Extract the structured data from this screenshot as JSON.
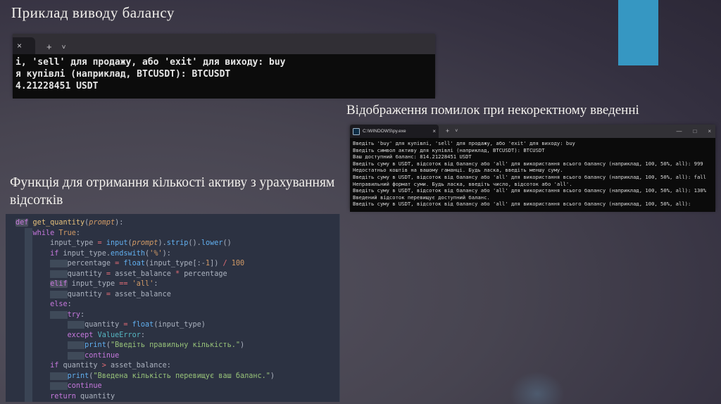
{
  "slide": {
    "title": "Приклад виводу балансу",
    "error_heading": "Відображення помилок при некоректному введенні",
    "function_heading": "Функція для отримання кількості активу з урахуванням відсотків"
  },
  "colors": {
    "accent_blue": "#3697c2",
    "terminal_bg": "#0c0c0c",
    "code_bg": "#2c3242",
    "slide_dark": "#272331"
  },
  "terminal_small": {
    "tab_close": "×",
    "new_tab": "+",
    "dropdown": "˅",
    "lines": [
      "і, 'sell' для продажу, або 'exit' для виходу: buy",
      "я купівлі (наприклад, BTCUSDT): BTCUSDT",
      "4.21228451 USDT"
    ]
  },
  "terminal_large": {
    "title": "C:\\WINDOWS\\py.exe",
    "tab_close": "×",
    "new_tab": "+",
    "dropdown": "˅",
    "window_controls": {
      "minimize": "—",
      "maximize": "□",
      "close": "×"
    },
    "lines": [
      "Введіть 'buy' для купівлі, 'sell' для продажу, або 'exit' для виходу: buy",
      "Введіть символ активу для купівлі (наприклад, BTCUSDT): BTCUSDT",
      "Ваш доступний баланс: 814.21228451 USDT",
      "Введіть суму в USDT, відсоток від балансу або 'all' для використання всього балансу (наприклад, 100, 50%, all): 999",
      "Недостатньо коштів на вашому гаманці. Будь ласка, введіть меншу суму.",
      "Введіть суму в USDT, відсоток від балансу або 'all' для використання всього балансу (наприклад, 100, 50%, all): fall",
      "Неправильний формат суми. Будь ласка, введіть число, відсоток або 'all'.",
      "Введіть суму в USDT, відсоток від балансу або 'all' для використання всього балансу (наприклад, 100, 50%, all): 130%",
      "Введений відсоток перевищує доступний баланс.",
      "Введіть суму в USDT, відсоток від балансу або 'all' для використання всього балансу (наприклад, 100, 50%, all):"
    ]
  },
  "code": {
    "language": "python",
    "lines": [
      {
        "tokens": [
          {
            "t": "def",
            "c": "k kbg"
          },
          {
            "t": " ",
            "c": "p"
          },
          {
            "t": "get_quantity",
            "c": "fn"
          },
          {
            "t": "(",
            "c": "p"
          },
          {
            "t": "prompt",
            "c": "pa"
          },
          {
            "t": "):",
            "c": "p"
          }
        ]
      },
      {
        "tokens": [
          {
            "t": "    ",
            "c": "p"
          },
          {
            "t": "while",
            "c": "k"
          },
          {
            "t": " ",
            "c": "p"
          },
          {
            "t": "True",
            "c": "num"
          },
          {
            "t": ":",
            "c": "p"
          }
        ]
      },
      {
        "tokens": [
          {
            "t": "        ",
            "c": "p"
          },
          {
            "t": "input_type ",
            "c": "p"
          },
          {
            "t": "=",
            "c": "op"
          },
          {
            "t": " ",
            "c": "p"
          },
          {
            "t": "input",
            "c": "bi"
          },
          {
            "t": "(",
            "c": "p"
          },
          {
            "t": "prompt",
            "c": "pa"
          },
          {
            "t": ").",
            "c": "p"
          },
          {
            "t": "strip",
            "c": "bi"
          },
          {
            "t": "().",
            "c": "p"
          },
          {
            "t": "lower",
            "c": "bi"
          },
          {
            "t": "()",
            "c": "p"
          }
        ]
      },
      {
        "tokens": [
          {
            "t": "        ",
            "c": "p"
          },
          {
            "t": "if",
            "c": "k"
          },
          {
            "t": " input_type.",
            "c": "p"
          },
          {
            "t": "endswith",
            "c": "bi"
          },
          {
            "t": "(",
            "c": "p"
          },
          {
            "t": "'%'",
            "c": "str2"
          },
          {
            "t": "):",
            "c": "p"
          }
        ]
      },
      {
        "tokens": [
          {
            "t": "        ",
            "c": "p"
          },
          {
            "t": "    ",
            "c": "ghost"
          },
          {
            "t": "percentage ",
            "c": "p"
          },
          {
            "t": "=",
            "c": "op"
          },
          {
            "t": " ",
            "c": "p"
          },
          {
            "t": "float",
            "c": "bi"
          },
          {
            "t": "(input_type[:-",
            "c": "p"
          },
          {
            "t": "1",
            "c": "num"
          },
          {
            "t": "]) ",
            "c": "p"
          },
          {
            "t": "/",
            "c": "op"
          },
          {
            "t": " ",
            "c": "p"
          },
          {
            "t": "100",
            "c": "num"
          }
        ]
      },
      {
        "tokens": [
          {
            "t": "        ",
            "c": "p"
          },
          {
            "t": "    ",
            "c": "ghost"
          },
          {
            "t": "quantity ",
            "c": "p"
          },
          {
            "t": "=",
            "c": "op"
          },
          {
            "t": " asset_balance ",
            "c": "p"
          },
          {
            "t": "*",
            "c": "op"
          },
          {
            "t": " percentage",
            "c": "p"
          }
        ]
      },
      {
        "tokens": [
          {
            "t": "        ",
            "c": "p"
          },
          {
            "t": "elif",
            "c": "k kbg"
          },
          {
            "t": " input_type ",
            "c": "p"
          },
          {
            "t": "==",
            "c": "op"
          },
          {
            "t": " ",
            "c": "p"
          },
          {
            "t": "'all'",
            "c": "str2"
          },
          {
            "t": ":",
            "c": "p"
          }
        ]
      },
      {
        "tokens": [
          {
            "t": "        ",
            "c": "p"
          },
          {
            "t": "    ",
            "c": "ghost"
          },
          {
            "t": "quantity ",
            "c": "p"
          },
          {
            "t": "=",
            "c": "op"
          },
          {
            "t": " asset_balance",
            "c": "p"
          }
        ]
      },
      {
        "tokens": [
          {
            "t": "        ",
            "c": "p"
          },
          {
            "t": "else",
            "c": "k"
          },
          {
            "t": ":",
            "c": "p"
          }
        ]
      },
      {
        "tokens": [
          {
            "t": "        ",
            "c": "p"
          },
          {
            "t": "    ",
            "c": "ghost"
          },
          {
            "t": "try",
            "c": "k"
          },
          {
            "t": ":",
            "c": "p"
          }
        ]
      },
      {
        "tokens": [
          {
            "t": "            ",
            "c": "p"
          },
          {
            "t": "    ",
            "c": "ghost"
          },
          {
            "t": "quantity ",
            "c": "p"
          },
          {
            "t": "=",
            "c": "op"
          },
          {
            "t": " ",
            "c": "p"
          },
          {
            "t": "float",
            "c": "bi"
          },
          {
            "t": "(input_type)",
            "c": "p"
          }
        ]
      },
      {
        "tokens": [
          {
            "t": "            ",
            "c": "p"
          },
          {
            "t": "except",
            "c": "k"
          },
          {
            "t": " ",
            "c": "p"
          },
          {
            "t": "ValueError",
            "c": "cls"
          },
          {
            "t": ":",
            "c": "p"
          }
        ]
      },
      {
        "tokens": [
          {
            "t": "            ",
            "c": "p"
          },
          {
            "t": "    ",
            "c": "ghost"
          },
          {
            "t": "print",
            "c": "bi"
          },
          {
            "t": "(",
            "c": "p"
          },
          {
            "t": "\"Введіть правильну кількість.\"",
            "c": "str"
          },
          {
            "t": ")",
            "c": "p"
          }
        ]
      },
      {
        "tokens": [
          {
            "t": "            ",
            "c": "p"
          },
          {
            "t": "    ",
            "c": "ghost"
          },
          {
            "t": "continue",
            "c": "k"
          }
        ]
      },
      {
        "tokens": [
          {
            "t": "        ",
            "c": "p"
          },
          {
            "t": "if",
            "c": "k"
          },
          {
            "t": " quantity ",
            "c": "p"
          },
          {
            "t": ">",
            "c": "op"
          },
          {
            "t": " asset_balance:",
            "c": "p"
          }
        ]
      },
      {
        "tokens": [
          {
            "t": "        ",
            "c": "p"
          },
          {
            "t": "    ",
            "c": "ghost"
          },
          {
            "t": "print",
            "c": "bi"
          },
          {
            "t": "(",
            "c": "p"
          },
          {
            "t": "\"Введена кількість перевищує ваш баланс.\"",
            "c": "str"
          },
          {
            "t": ")",
            "c": "p"
          }
        ]
      },
      {
        "tokens": [
          {
            "t": "        ",
            "c": "p"
          },
          {
            "t": "    ",
            "c": "ghost"
          },
          {
            "t": "continue",
            "c": "k"
          }
        ]
      },
      {
        "tokens": [
          {
            "t": "        ",
            "c": "p"
          },
          {
            "t": "return",
            "c": "k"
          },
          {
            "t": " quantity",
            "c": "p"
          }
        ]
      }
    ]
  }
}
